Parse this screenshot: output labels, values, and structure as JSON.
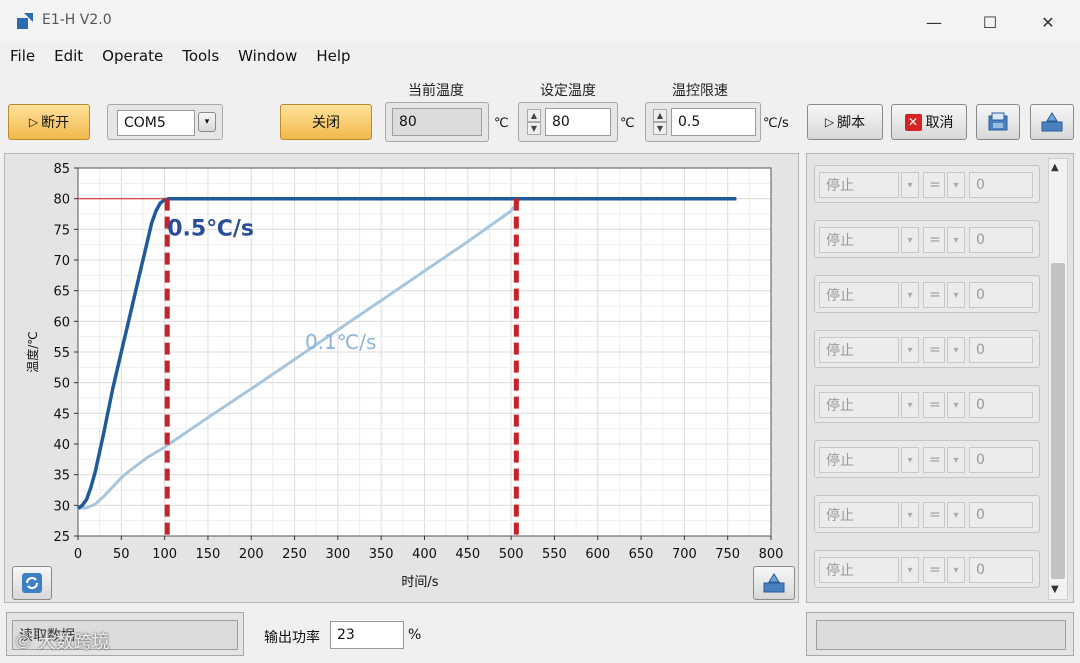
{
  "window": {
    "title": "E1-H V2.0",
    "minimize": "—",
    "maximize": "☐",
    "close": "✕"
  },
  "menu": [
    "File",
    "Edit",
    "Operate",
    "Tools",
    "Window",
    "Help"
  ],
  "toolbar": {
    "disconnect_label": "断开",
    "port_value": "COM5",
    "close_label": "关闭",
    "current_temp_label": "当前温度",
    "current_temp_value": "80",
    "current_temp_unit": "℃",
    "set_temp_label": "设定温度",
    "set_temp_value": "80",
    "set_temp_unit": "℃",
    "rate_label": "温控限速",
    "rate_value": "0.5",
    "rate_unit": "℃/s",
    "script_label": "脚本",
    "cancel_label": "取消"
  },
  "colors": {
    "fast_series": "#1f5a9a",
    "slow_series": "#a7c6de",
    "setpoint_line": "#d9534f",
    "marker_line": "#c4232a",
    "annotation_fast": "#2a4f96",
    "annotation_slow": "#8fb3d9"
  },
  "chart_data": {
    "type": "line",
    "xlabel": "时间/s",
    "ylabel": "温度/℃",
    "xlim": [
      0,
      800
    ],
    "ylim": [
      25,
      85
    ],
    "xticks": [
      0,
      50,
      100,
      150,
      200,
      250,
      300,
      350,
      400,
      450,
      500,
      550,
      600,
      650,
      700,
      750,
      800
    ],
    "yticks": [
      25,
      30,
      35,
      40,
      45,
      50,
      55,
      60,
      65,
      70,
      75,
      80,
      85
    ],
    "grid": true,
    "series": [
      {
        "x": [
          0,
          5,
          10,
          15,
          20,
          30,
          40,
          50,
          60,
          70,
          80,
          85,
          90,
          95,
          100,
          105,
          110,
          200,
          300,
          400,
          500,
          600,
          700,
          760
        ],
        "y": [
          29.5,
          30,
          31,
          33,
          35.5,
          42,
          49,
          55,
          61,
          67,
          73,
          76,
          78,
          79.3,
          79.8,
          80,
          80,
          80,
          80,
          80,
          80,
          80,
          80,
          80
        ]
      },
      {
        "x": [
          0,
          10,
          20,
          30,
          40,
          50,
          60,
          80,
          100,
          150,
          200,
          250,
          300,
          350,
          400,
          450,
          500,
          505,
          510,
          600,
          700,
          760
        ],
        "y": [
          29.5,
          29.6,
          30.2,
          31.5,
          33,
          34.5,
          35.7,
          37.8,
          39.5,
          44.3,
          49,
          53.8,
          58.6,
          63.4,
          68.2,
          73,
          78,
          79,
          80,
          80,
          80,
          80
        ]
      }
    ],
    "setpoint": {
      "y": 80,
      "x": [
        0,
        105
      ]
    },
    "markers_x": [
      103,
      506
    ],
    "annotations": [
      {
        "text": "0.5℃/s",
        "x": 103,
        "y": 75
      },
      {
        "text": "0.1℃/s",
        "x": 262,
        "y": 56.5
      }
    ]
  },
  "right_panel": {
    "rows": [
      {
        "action": "停止",
        "op": "=",
        "value": "0"
      },
      {
        "action": "停止",
        "op": "=",
        "value": "0"
      },
      {
        "action": "停止",
        "op": "=",
        "value": "0"
      },
      {
        "action": "停止",
        "op": "=",
        "value": "0"
      },
      {
        "action": "停止",
        "op": "=",
        "value": "0"
      },
      {
        "action": "停止",
        "op": "=",
        "value": "0"
      },
      {
        "action": "停止",
        "op": "=",
        "value": "0"
      },
      {
        "action": "停止",
        "op": "=",
        "value": "0"
      }
    ]
  },
  "status": {
    "left_text": "读取数据",
    "power_label": "输出功率",
    "power_value": "23",
    "power_unit": "%",
    "watermark": "大数跨境"
  },
  "icons": [
    "app-icon",
    "play-icon",
    "refresh-icon",
    "save-icon",
    "export-icon",
    "cancel-x-icon"
  ]
}
